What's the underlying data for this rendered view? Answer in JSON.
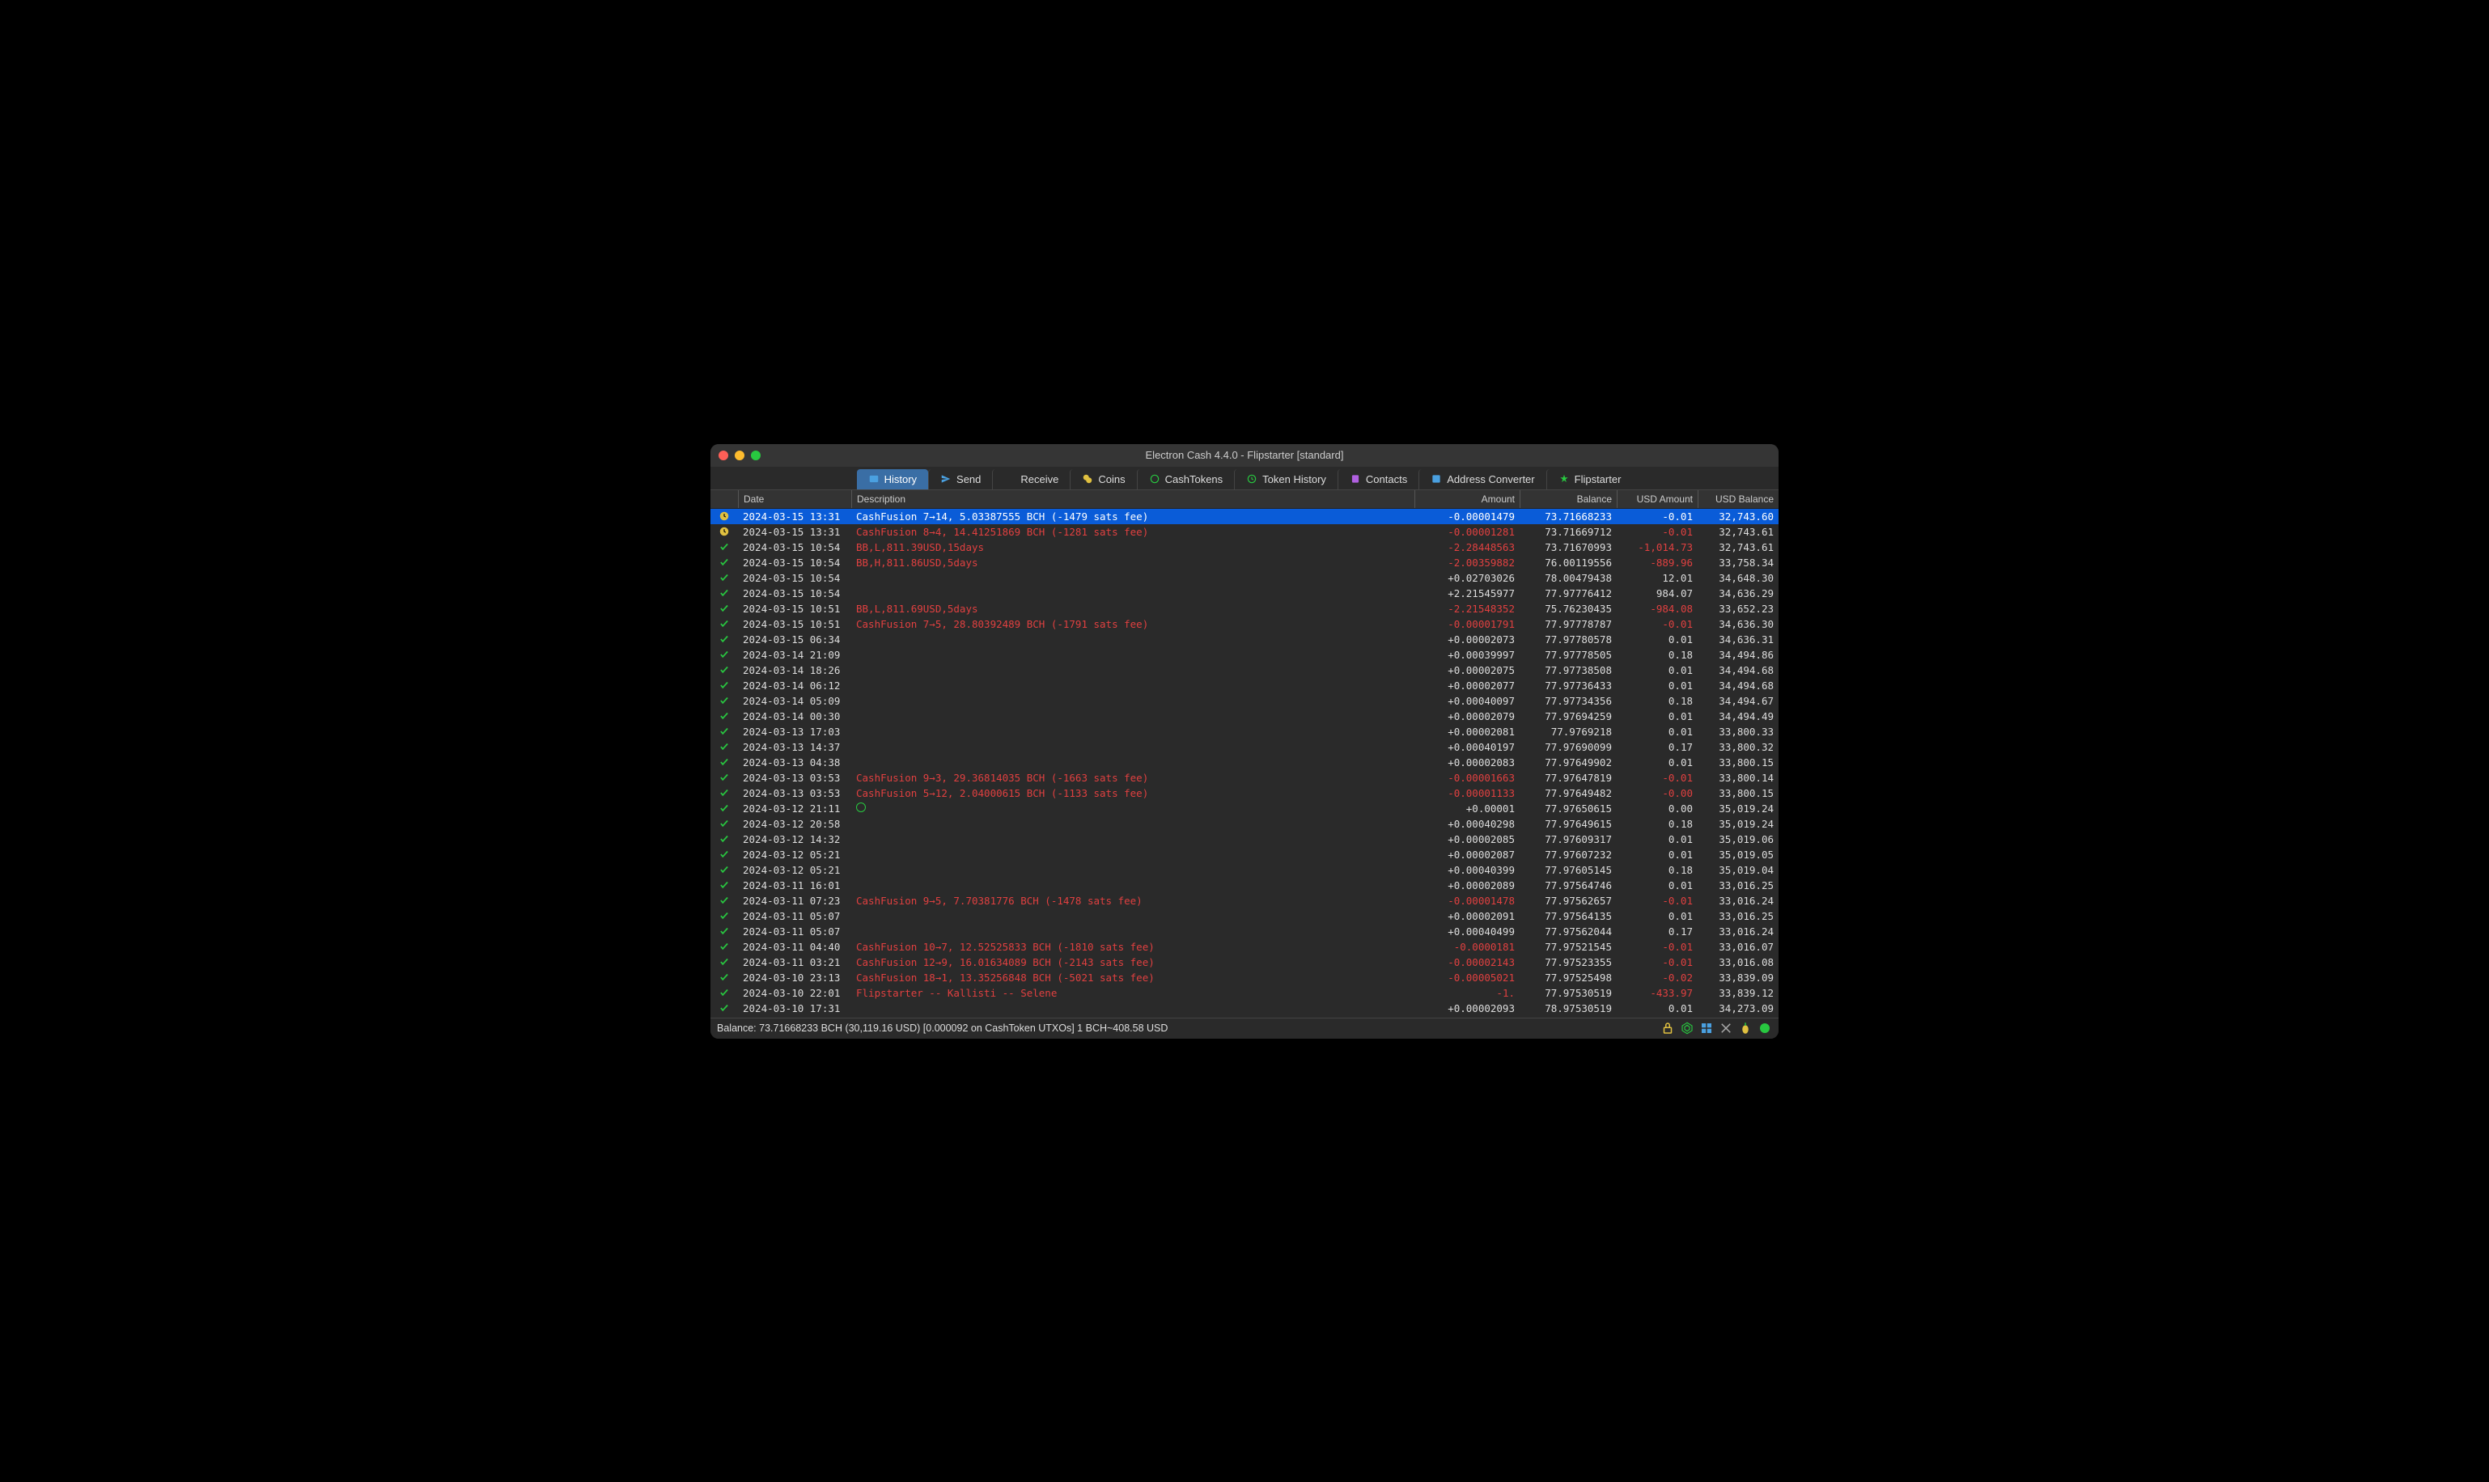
{
  "window": {
    "title": "Electron Cash 4.4.0  -  Flipstarter  [standard]"
  },
  "tabs": [
    {
      "id": "history",
      "label": "History",
      "active": true
    },
    {
      "id": "send",
      "label": "Send"
    },
    {
      "id": "receive",
      "label": "Receive"
    },
    {
      "id": "coins",
      "label": "Coins"
    },
    {
      "id": "cashtokens",
      "label": "CashTokens"
    },
    {
      "id": "token-history",
      "label": "Token History"
    },
    {
      "id": "contacts",
      "label": "Contacts"
    },
    {
      "id": "address-converter",
      "label": "Address Converter"
    },
    {
      "id": "flipstarter",
      "label": "Flipstarter"
    }
  ],
  "columns": {
    "date": "Date",
    "description": "Description",
    "amount": "Amount",
    "balance": "Balance",
    "usd_amount": "USD Amount",
    "usd_balance": "USD Balance"
  },
  "transactions": [
    {
      "status": "clock",
      "selected": true,
      "date": "2024-03-15 13:31",
      "desc": "CashFusion 7→14, 5.03387555 BCH (-1479 sats fee)",
      "desc_red": false,
      "amount": "-0.00001479",
      "amt_neg": true,
      "balance": "73.71668233",
      "usd_amount": "-0.01",
      "usd_neg": true,
      "usd_balance": "32,743.60"
    },
    {
      "status": "clock",
      "date": "2024-03-15 13:31",
      "desc": "CashFusion 8→4, 14.41251869 BCH (-1281 sats fee)",
      "desc_red": true,
      "amount": "-0.00001281",
      "amt_neg": true,
      "balance": "73.71669712",
      "usd_amount": "-0.01",
      "usd_neg": true,
      "usd_balance": "32,743.61"
    },
    {
      "status": "check",
      "date": "2024-03-15 10:54",
      "desc": "BB,L,811.39USD,15days",
      "desc_red": true,
      "amount": "-2.28448563",
      "amt_neg": true,
      "balance": "73.71670993",
      "usd_amount": "-1,014.73",
      "usd_neg": true,
      "usd_balance": "32,743.61"
    },
    {
      "status": "check",
      "date": "2024-03-15 10:54",
      "desc": "BB,H,811.86USD,5days",
      "desc_red": true,
      "amount": "-2.00359882",
      "amt_neg": true,
      "balance": "76.00119556",
      "usd_amount": "-889.96",
      "usd_neg": true,
      "usd_balance": "33,758.34"
    },
    {
      "status": "check",
      "date": "2024-03-15 10:54",
      "desc": "",
      "amount": "+0.02703026",
      "balance": "78.00479438",
      "usd_amount": "12.01",
      "usd_balance": "34,648.30"
    },
    {
      "status": "check",
      "date": "2024-03-15 10:54",
      "desc": "",
      "amount": "+2.21545977",
      "balance": "77.97776412",
      "usd_amount": "984.07",
      "usd_balance": "34,636.29"
    },
    {
      "status": "check",
      "date": "2024-03-15 10:51",
      "desc": "BB,L,811.69USD,5days",
      "desc_red": true,
      "amount": "-2.21548352",
      "amt_neg": true,
      "balance": "75.76230435",
      "usd_amount": "-984.08",
      "usd_neg": true,
      "usd_balance": "33,652.23"
    },
    {
      "status": "check",
      "date": "2024-03-15 10:51",
      "desc": "CashFusion 7→5, 28.80392489 BCH (-1791 sats fee)",
      "desc_red": true,
      "amount": "-0.00001791",
      "amt_neg": true,
      "balance": "77.97778787",
      "usd_amount": "-0.01",
      "usd_neg": true,
      "usd_balance": "34,636.30"
    },
    {
      "status": "check",
      "date": "2024-03-15 06:34",
      "desc": "",
      "amount": "+0.00002073",
      "balance": "77.97780578",
      "usd_amount": "0.01",
      "usd_balance": "34,636.31"
    },
    {
      "status": "check",
      "date": "2024-03-14 21:09",
      "desc": "",
      "amount": "+0.00039997",
      "balance": "77.97778505",
      "usd_amount": "0.18",
      "usd_balance": "34,494.86"
    },
    {
      "status": "check",
      "date": "2024-03-14 18:26",
      "desc": "",
      "amount": "+0.00002075",
      "balance": "77.97738508",
      "usd_amount": "0.01",
      "usd_balance": "34,494.68"
    },
    {
      "status": "check",
      "date": "2024-03-14 06:12",
      "desc": "",
      "amount": "+0.00002077",
      "balance": "77.97736433",
      "usd_amount": "0.01",
      "usd_balance": "34,494.68"
    },
    {
      "status": "check",
      "date": "2024-03-14 05:09",
      "desc": "",
      "amount": "+0.00040097",
      "balance": "77.97734356",
      "usd_amount": "0.18",
      "usd_balance": "34,494.67"
    },
    {
      "status": "check",
      "date": "2024-03-14 00:30",
      "desc": "",
      "amount": "+0.00002079",
      "balance": "77.97694259",
      "usd_amount": "0.01",
      "usd_balance": "34,494.49"
    },
    {
      "status": "check",
      "date": "2024-03-13 17:03",
      "desc": "",
      "amount": "+0.00002081",
      "balance": "77.9769218",
      "usd_amount": "0.01",
      "usd_balance": "33,800.33"
    },
    {
      "status": "check",
      "date": "2024-03-13 14:37",
      "desc": "",
      "amount": "+0.00040197",
      "balance": "77.97690099",
      "usd_amount": "0.17",
      "usd_balance": "33,800.32"
    },
    {
      "status": "check",
      "date": "2024-03-13 04:38",
      "desc": "",
      "amount": "+0.00002083",
      "balance": "77.97649902",
      "usd_amount": "0.01",
      "usd_balance": "33,800.15"
    },
    {
      "status": "check",
      "date": "2024-03-13 03:53",
      "desc": "CashFusion 9→3, 29.36814035 BCH (-1663 sats fee)",
      "desc_red": true,
      "amount": "-0.00001663",
      "amt_neg": true,
      "balance": "77.97647819",
      "usd_amount": "-0.01",
      "usd_neg": true,
      "usd_balance": "33,800.14"
    },
    {
      "status": "check",
      "date": "2024-03-13 03:53",
      "desc": "CashFusion 5→12, 2.04000615 BCH (-1133 sats fee)",
      "desc_red": true,
      "amount": "-0.00001133",
      "amt_neg": true,
      "balance": "77.97649482",
      "usd_amount": "-0.00",
      "usd_neg": true,
      "usd_balance": "33,800.15"
    },
    {
      "status": "check",
      "date": "2024-03-12 21:11",
      "desc_icon": "circle",
      "desc": "",
      "amount": "+0.00001",
      "balance": "77.97650615",
      "usd_amount": "0.00",
      "usd_balance": "35,019.24"
    },
    {
      "status": "check",
      "date": "2024-03-12 20:58",
      "desc": "",
      "amount": "+0.00040298",
      "balance": "77.97649615",
      "usd_amount": "0.18",
      "usd_balance": "35,019.24"
    },
    {
      "status": "check",
      "date": "2024-03-12 14:32",
      "desc": "",
      "amount": "+0.00002085",
      "balance": "77.97609317",
      "usd_amount": "0.01",
      "usd_balance": "35,019.06"
    },
    {
      "status": "check",
      "date": "2024-03-12 05:21",
      "desc": "",
      "amount": "+0.00002087",
      "balance": "77.97607232",
      "usd_amount": "0.01",
      "usd_balance": "35,019.05"
    },
    {
      "status": "check",
      "date": "2024-03-12 05:21",
      "desc": "",
      "amount": "+0.00040399",
      "balance": "77.97605145",
      "usd_amount": "0.18",
      "usd_balance": "35,019.04"
    },
    {
      "status": "check",
      "date": "2024-03-11 16:01",
      "desc": "",
      "amount": "+0.00002089",
      "balance": "77.97564746",
      "usd_amount": "0.01",
      "usd_balance": "33,016.25"
    },
    {
      "status": "check",
      "date": "2024-03-11 07:23",
      "desc": "CashFusion 9→5, 7.70381776 BCH (-1478 sats fee)",
      "desc_red": true,
      "amount": "-0.00001478",
      "amt_neg": true,
      "balance": "77.97562657",
      "usd_amount": "-0.01",
      "usd_neg": true,
      "usd_balance": "33,016.24"
    },
    {
      "status": "check",
      "date": "2024-03-11 05:07",
      "desc": "",
      "amount": "+0.00002091",
      "balance": "77.97564135",
      "usd_amount": "0.01",
      "usd_balance": "33,016.25"
    },
    {
      "status": "check",
      "date": "2024-03-11 05:07",
      "desc": "",
      "amount": "+0.00040499",
      "balance": "77.97562044",
      "usd_amount": "0.17",
      "usd_balance": "33,016.24"
    },
    {
      "status": "check",
      "date": "2024-03-11 04:40",
      "desc": "CashFusion 10→7, 12.52525833 BCH (-1810 sats fee)",
      "desc_red": true,
      "amount": "-0.0000181",
      "amt_neg": true,
      "balance": "77.97521545",
      "usd_amount": "-0.01",
      "usd_neg": true,
      "usd_balance": "33,016.07"
    },
    {
      "status": "check",
      "date": "2024-03-11 03:21",
      "desc": "CashFusion 12→9, 16.01634089 BCH (-2143 sats fee)",
      "desc_red": true,
      "amount": "-0.00002143",
      "amt_neg": true,
      "balance": "77.97523355",
      "usd_amount": "-0.01",
      "usd_neg": true,
      "usd_balance": "33,016.08"
    },
    {
      "status": "check",
      "date": "2024-03-10 23:13",
      "desc": "CashFusion 18→1, 13.35256848 BCH (-5021 sats fee)",
      "desc_red": true,
      "amount": "-0.00005021",
      "amt_neg": true,
      "balance": "77.97525498",
      "usd_amount": "-0.02",
      "usd_neg": true,
      "usd_balance": "33,839.09"
    },
    {
      "status": "check",
      "date": "2024-03-10 22:01",
      "desc": "Flipstarter -- Kallisti -- Selene",
      "desc_red": true,
      "amount": "-1.",
      "amt_neg": true,
      "balance": "77.97530519",
      "usd_amount": "-433.97",
      "usd_neg": true,
      "usd_balance": "33,839.12"
    },
    {
      "status": "check",
      "date": "2024-03-10 17:31",
      "desc": "",
      "amount": "+0.00002093",
      "balance": "78.97530519",
      "usd_amount": "0.01",
      "usd_balance": "34,273.09"
    }
  ],
  "statusbar": {
    "balance": "Balance: 73.71668233 BCH (30,119.16 USD) [0.000092 on CashToken UTXOs] 1 BCH~408.58 USD"
  }
}
